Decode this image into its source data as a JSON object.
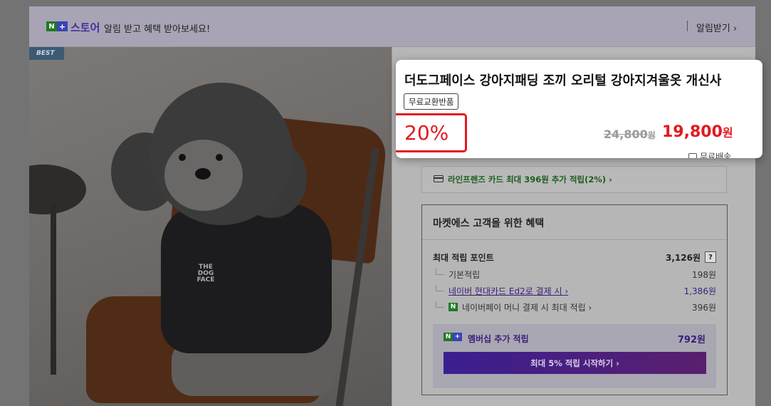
{
  "banner": {
    "logo_n": "N",
    "logo_plus": "+",
    "store_label": "스토어",
    "message": "알림 받고 혜택 받아보세요!",
    "alarm_link": "알림받기 ›"
  },
  "photo": {
    "badge": "BEST",
    "vest_logo": "THE DOG FACE"
  },
  "product": {
    "title": "더도그페이스 강아지패딩 조끼 오리털 강아지겨울옷 개신사",
    "tag": "무료교환반품",
    "discount": "20%",
    "original_price": "24,800",
    "original_unit": "원",
    "sale_price": "19,800",
    "sale_unit": "원",
    "shipping": "무료배송"
  },
  "card_promo": {
    "text": "라인프렌즈 카드 최대 396원 추가 적립(2%) ›"
  },
  "benefits": {
    "title": "마켓에스 고객을 위한 혜택",
    "max_points_label": "최대 적립 포인트",
    "max_points_value": "3,126원",
    "help": "?",
    "rows": [
      {
        "label": "기본적립",
        "value": "198원"
      },
      {
        "label": "네이버 현대카드 Ed2로 결제 시 ›",
        "value": "1,386원"
      },
      {
        "label": "네이버페이 머니 결제 시 최대 적립 ›",
        "value": "396원"
      }
    ],
    "pay_icon": "N",
    "member_label": "멤버십 추가 적립",
    "member_value": "792원",
    "member_button": "최대 5% 적립 시작하기 ›"
  },
  "colors": {
    "discount_red": "#e2191f",
    "naver_green": "#1f7a26",
    "naver_purple": "#3a1e7a"
  }
}
